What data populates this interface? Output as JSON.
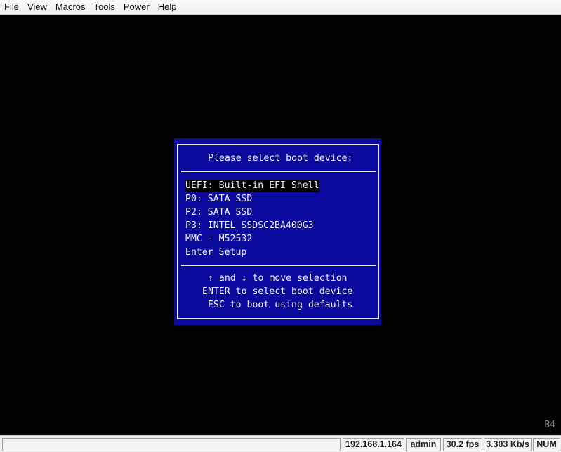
{
  "menu": [
    "File",
    "View",
    "Macros",
    "Tools",
    "Power",
    "Help"
  ],
  "bios": {
    "title": "Please select boot device:",
    "items": [
      "UEFI: Built-in EFI Shell",
      "P0: SATA SSD",
      "P2: SATA SSD",
      "P3: INTEL SSDSC2BA400G3",
      "MMC - M52532",
      "Enter Setup"
    ],
    "selected_index": 0,
    "help": [
      "↑ and ↓ to move selection",
      "ENTER to select boot device",
      " ESC to boot using defaults"
    ]
  },
  "post_code": "B4",
  "status": {
    "message": "",
    "ip": "192.168.1.164",
    "user": "admin",
    "fps": "30.2 fps",
    "bandwidth": "3.303 Kb/s",
    "num": "NUM"
  }
}
